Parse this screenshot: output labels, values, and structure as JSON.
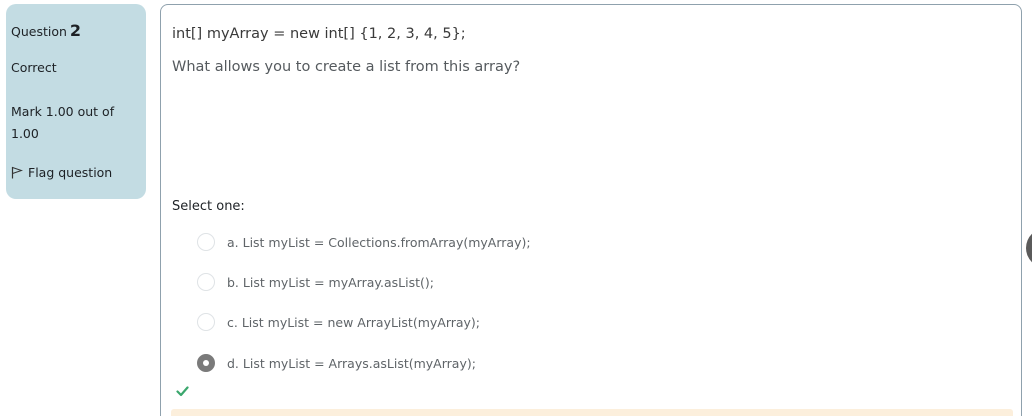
{
  "info": {
    "question_prefix": "Question",
    "question_number": "2",
    "state": "Correct",
    "grade": "Mark 1.00 out of 1.00",
    "flag_label": "Flag question"
  },
  "question": {
    "code": "int[] myArray = new int[] {1, 2, 3, 4, 5};",
    "text": "What allows you to create a list from this array?",
    "prompt": "Select one:",
    "options": [
      {
        "label": "a. List myList = Collections.fromArray(myArray);",
        "selected": false
      },
      {
        "label": "b. List myList = myArray.asList();",
        "selected": false
      },
      {
        "label": "c. List myList = new ArrayList(myArray);",
        "selected": false
      },
      {
        "label": "d. List myList = Arrays.asList(myArray);",
        "selected": true
      }
    ],
    "result_icon": "check-icon"
  },
  "colors": {
    "info_background": "#c3dce3",
    "correct_check": "#3aa76d",
    "feedback_background": "#fcefdc"
  }
}
